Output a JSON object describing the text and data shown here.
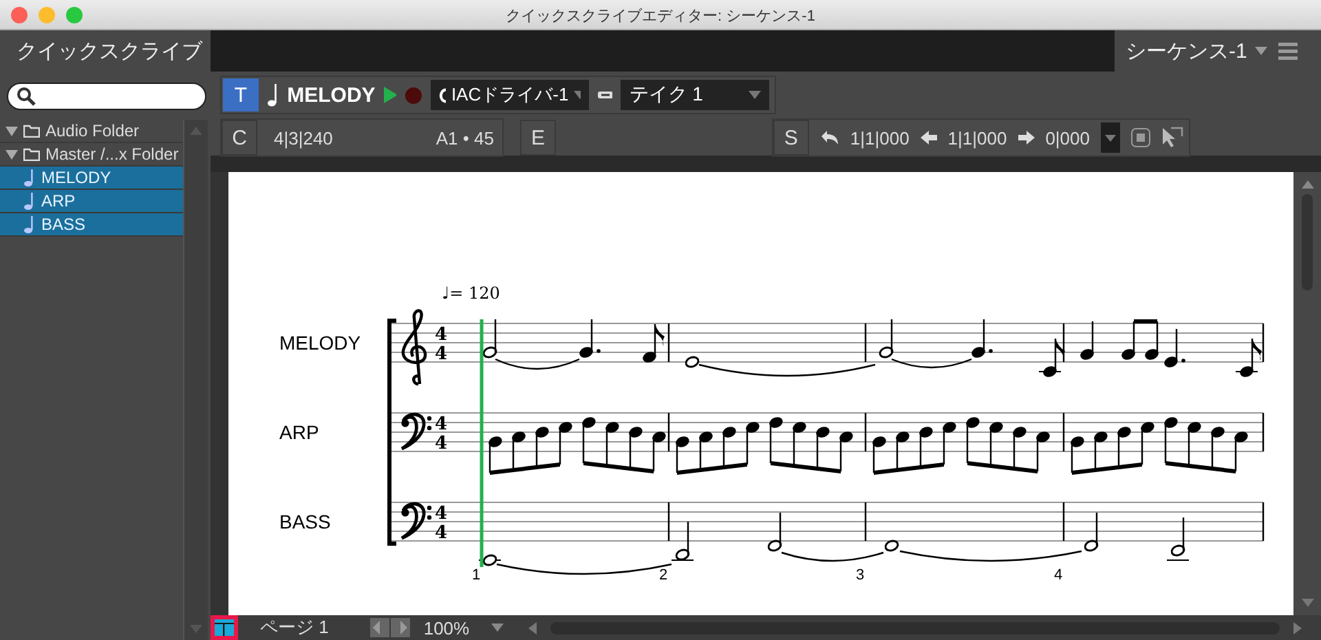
{
  "window": {
    "title": "クイックスクライブエディター: シーケンス-1"
  },
  "tabs": [
    {
      "label": "クイックスクライブ",
      "selected": true
    }
  ],
  "sequence_menu": {
    "label": "シーケンス-1"
  },
  "sidebar": {
    "items": [
      {
        "label": "Audio Folder",
        "kind": "folder",
        "expanded": true,
        "selected": false
      },
      {
        "label": "Master /...x Folder",
        "kind": "folder",
        "expanded": true,
        "selected": false,
        "children": [
          {
            "label": "MELODY",
            "kind": "track",
            "selected": true
          },
          {
            "label": "ARP",
            "kind": "track",
            "selected": true
          },
          {
            "label": "BASS",
            "kind": "track",
            "selected": true
          }
        ]
      }
    ]
  },
  "track_bar": {
    "type_button": "T",
    "track_name": "MELODY",
    "output": "IACドライバ-1",
    "take": "テイク 1"
  },
  "info_bar": {
    "c_button": "C",
    "position": "4|3|240",
    "pitch": "A1 • 45",
    "e_button": "E"
  },
  "transport_bar": {
    "s_button": "S",
    "start": "1|1|000",
    "end": "1|1|000",
    "length": "0|000"
  },
  "score": {
    "tempo": "♩= 120",
    "staffs": [
      {
        "name": "MELODY",
        "kind": "treble",
        "time_signature": [
          "4",
          "4"
        ]
      },
      {
        "name": "ARP",
        "kind": "bass",
        "time_signature": [
          "4",
          "4"
        ]
      },
      {
        "name": "BASS",
        "kind": "bass",
        "time_signature": [
          "4",
          "4"
        ]
      }
    ],
    "measure_numbers": [
      "1",
      "2",
      "3",
      "4"
    ]
  },
  "status_bar": {
    "page": "ページ 1",
    "zoom": "100%"
  }
}
